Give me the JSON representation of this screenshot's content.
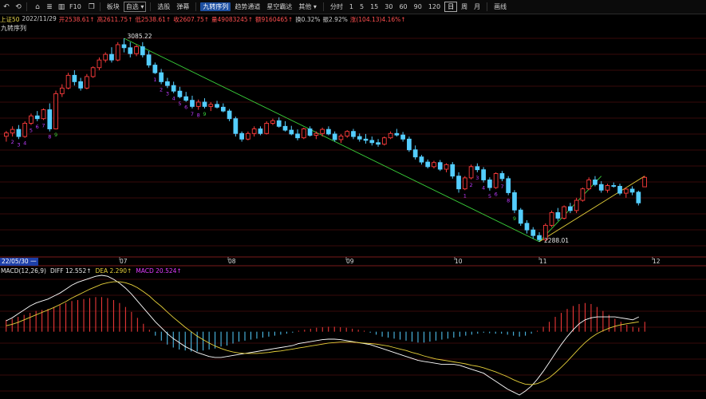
{
  "toolbar": {
    "icons": [
      "back-arrow-icon",
      "refresh-icon",
      "home-icon",
      "list-icon",
      "chart-icon",
      "f10-icon",
      "window-icon"
    ],
    "labels": {
      "f10": "F10",
      "blocks": "板块",
      "self": "自选",
      "select": "选股",
      "barrage": "弹幕",
      "jiuzhuan": "九转序列",
      "trend": "趋势通道",
      "dragon": "星空霸达",
      "other": "其他"
    },
    "periods": [
      "分时",
      "1",
      "5",
      "15",
      "30",
      "60",
      "90",
      "120",
      "日",
      "周",
      "月"
    ],
    "active_period": "日",
    "draw": "画线"
  },
  "info": {
    "name": "上证50",
    "date": "2022/11/29",
    "open": "开2538.61↑",
    "high": "高2611.75↑",
    "low": "低2538.61↑",
    "close": "收2607.75↑",
    "volume": "量49083245↑",
    "amount": "额9160465↑",
    "turnover": "换0.32%",
    "amplitude": "振2.92%",
    "change": "涨(104.13)4.16%↑"
  },
  "seq_label": "九转序列",
  "macd_legend": {
    "title": "MACD(12,26,9)",
    "diff": "DIFF 12.552↑",
    "dea": "DEA 2.290↑",
    "macd": "MACD 20.524↑"
  },
  "colors": {
    "up": "#ff3c3c",
    "down": "#54ceff",
    "diff": "#ffffff",
    "dea": "#e6d13a",
    "seq": "#c03cff",
    "seq9": "#3ad13a",
    "trend": "#3ad13a"
  },
  "chart_data": {
    "type": "candlestick",
    "title": "上证50",
    "annotations": {
      "high": "3085.22",
      "low": "2288.01"
    },
    "xlabels": [
      "22/05/30 一",
      "07",
      "08",
      "09",
      "10",
      "11",
      "12"
    ],
    "ylim": [
      2250,
      3110
    ],
    "candles": [
      [
        2701,
        2722,
        2680,
        2714
      ],
      [
        2714,
        2740,
        2700,
        2728
      ],
      [
        2728,
        2745,
        2690,
        2700
      ],
      [
        2700,
        2760,
        2695,
        2752
      ],
      [
        2752,
        2790,
        2745,
        2781
      ],
      [
        2781,
        2800,
        2760,
        2770
      ],
      [
        2770,
        2810,
        2765,
        2805
      ],
      [
        2805,
        2830,
        2720,
        2730
      ],
      [
        2730,
        2880,
        2728,
        2868
      ],
      [
        2868,
        2905,
        2855,
        2890
      ],
      [
        2890,
        2950,
        2885,
        2940
      ],
      [
        2940,
        2960,
        2900,
        2915
      ],
      [
        2915,
        2930,
        2880,
        2890
      ],
      [
        2890,
        2945,
        2885,
        2935
      ],
      [
        2935,
        2975,
        2930,
        2970
      ],
      [
        2970,
        3010,
        2960,
        3000
      ],
      [
        3000,
        3030,
        2990,
        3022
      ],
      [
        3022,
        3050,
        2990,
        3000
      ],
      [
        3000,
        3070,
        2995,
        3060
      ],
      [
        3060,
        3085,
        3030,
        3048
      ],
      [
        3048,
        3070,
        3010,
        3025
      ],
      [
        3025,
        3060,
        3015,
        3052
      ],
      [
        3052,
        3070,
        3010,
        3020
      ],
      [
        3020,
        3035,
        2970,
        2980
      ],
      [
        2980,
        2990,
        2945,
        2950
      ],
      [
        2950,
        2965,
        2905,
        2915
      ],
      [
        2915,
        2930,
        2890,
        2900
      ],
      [
        2900,
        2915,
        2870,
        2878
      ],
      [
        2878,
        2895,
        2850,
        2856
      ],
      [
        2856,
        2875,
        2836,
        2842
      ],
      [
        2842,
        2860,
        2810,
        2818
      ],
      [
        2818,
        2845,
        2805,
        2835
      ],
      [
        2835,
        2850,
        2810,
        2818
      ],
      [
        2818,
        2835,
        2800,
        2826
      ],
      [
        2826,
        2840,
        2810,
        2815
      ],
      [
        2815,
        2830,
        2795,
        2800
      ],
      [
        2800,
        2808,
        2760,
        2770
      ],
      [
        2770,
        2778,
        2700,
        2712
      ],
      [
        2712,
        2720,
        2680,
        2690
      ],
      [
        2690,
        2720,
        2685,
        2712
      ],
      [
        2712,
        2740,
        2700,
        2730
      ],
      [
        2730,
        2740,
        2705,
        2712
      ],
      [
        2712,
        2760,
        2708,
        2752
      ],
      [
        2752,
        2770,
        2745,
        2762
      ],
      [
        2762,
        2775,
        2735,
        2740
      ],
      [
        2740,
        2760,
        2720,
        2725
      ],
      [
        2725,
        2742,
        2705,
        2710
      ],
      [
        2710,
        2728,
        2685,
        2695
      ],
      [
        2695,
        2735,
        2690,
        2730
      ],
      [
        2730,
        2740,
        2700,
        2705
      ],
      [
        2705,
        2720,
        2690,
        2712
      ],
      [
        2712,
        2735,
        2700,
        2728
      ],
      [
        2728,
        2740,
        2705,
        2710
      ],
      [
        2710,
        2720,
        2680,
        2688
      ],
      [
        2688,
        2710,
        2675,
        2702
      ],
      [
        2702,
        2725,
        2695,
        2720
      ],
      [
        2720,
        2730,
        2690,
        2700
      ],
      [
        2700,
        2712,
        2680,
        2690
      ],
      [
        2690,
        2710,
        2672,
        2685
      ],
      [
        2685,
        2700,
        2665,
        2676
      ],
      [
        2676,
        2690,
        2660,
        2670
      ],
      [
        2670,
        2700,
        2665,
        2695
      ],
      [
        2695,
        2720,
        2690,
        2712
      ],
      [
        2712,
        2730,
        2700,
        2706
      ],
      [
        2706,
        2718,
        2680,
        2690
      ],
      [
        2690,
        2700,
        2640,
        2648
      ],
      [
        2648,
        2665,
        2610,
        2620
      ],
      [
        2620,
        2628,
        2590,
        2600
      ],
      [
        2600,
        2610,
        2575,
        2582
      ],
      [
        2582,
        2605,
        2575,
        2598
      ],
      [
        2598,
        2608,
        2565,
        2572
      ],
      [
        2572,
        2595,
        2560,
        2590
      ],
      [
        2590,
        2600,
        2535,
        2545
      ],
      [
        2545,
        2560,
        2480,
        2495
      ],
      [
        2495,
        2545,
        2490,
        2538
      ],
      [
        2538,
        2590,
        2532,
        2582
      ],
      [
        2582,
        2595,
        2560,
        2570
      ],
      [
        2570,
        2580,
        2520,
        2530
      ],
      [
        2530,
        2540,
        2488,
        2500
      ],
      [
        2500,
        2560,
        2495,
        2555
      ],
      [
        2555,
        2565,
        2525,
        2535
      ],
      [
        2535,
        2545,
        2470,
        2480
      ],
      [
        2480,
        2490,
        2400,
        2412
      ],
      [
        2412,
        2420,
        2350,
        2360
      ],
      [
        2360,
        2372,
        2320,
        2334
      ],
      [
        2334,
        2345,
        2300,
        2312
      ],
      [
        2312,
        2325,
        2288,
        2296
      ],
      [
        2296,
        2360,
        2290,
        2352
      ],
      [
        2352,
        2410,
        2345,
        2402
      ],
      [
        2402,
        2420,
        2370,
        2380
      ],
      [
        2380,
        2430,
        2375,
        2425
      ],
      [
        2425,
        2440,
        2400,
        2410
      ],
      [
        2410,
        2460,
        2400,
        2450
      ],
      [
        2450,
        2500,
        2445,
        2495
      ],
      [
        2495,
        2540,
        2490,
        2530
      ],
      [
        2530,
        2545,
        2505,
        2512
      ],
      [
        2512,
        2525,
        2480,
        2490
      ],
      [
        2490,
        2515,
        2480,
        2508
      ],
      [
        2508,
        2520,
        2500,
        2505
      ],
      [
        2505,
        2515,
        2470,
        2478
      ],
      [
        2478,
        2500,
        2460,
        2494
      ],
      [
        2494,
        2505,
        2470,
        2482
      ],
      [
        2482,
        2488,
        2430,
        2440
      ],
      [
        2503,
        2545,
        2503,
        2540
      ]
    ],
    "macd": {
      "hist": [
        24,
        26,
        30,
        34,
        38,
        42,
        44,
        46,
        50,
        54,
        58,
        62,
        64,
        66,
        68,
        70,
        70,
        68,
        64,
        58,
        50,
        40,
        28,
        16,
        4,
        -8,
        -18,
        -26,
        -32,
        -36,
        -38,
        -40,
        -40,
        -38,
        -36,
        -34,
        -30,
        -28,
        -24,
        -20,
        -18,
        -16,
        -14,
        -12,
        -10,
        -8,
        -6,
        -4,
        -2,
        2,
        4,
        6,
        8,
        9,
        10,
        10,
        9,
        8,
        6,
        4,
        2,
        -2,
        -6,
        -10,
        -12,
        -14,
        -16,
        -18,
        -20,
        -22,
        -22,
        -20,
        -18,
        -16,
        -14,
        -12,
        -10,
        -8,
        -6,
        -4,
        -2,
        -3,
        -4,
        -4,
        -6,
        -8,
        -10,
        -8,
        -4,
        2,
        10,
        20,
        30,
        38,
        46,
        52,
        56,
        58,
        56,
        50,
        42,
        34,
        26,
        20,
        14,
        10,
        8,
        20
      ],
      "diff": [
        22,
        28,
        36,
        44,
        52,
        58,
        62,
        66,
        72,
        78,
        86,
        94,
        100,
        104,
        108,
        112,
        114,
        112,
        106,
        98,
        88,
        76,
        62,
        48,
        34,
        20,
        8,
        -4,
        -14,
        -22,
        -30,
        -36,
        -42,
        -46,
        -50,
        -52,
        -52,
        -50,
        -48,
        -46,
        -44,
        -42,
        -40,
        -38,
        -36,
        -34,
        -32,
        -30,
        -28,
        -24,
        -22,
        -20,
        -18,
        -16,
        -15,
        -15,
        -16,
        -18,
        -20,
        -22,
        -24,
        -26,
        -30,
        -34,
        -38,
        -42,
        -46,
        -50,
        -54,
        -58,
        -60,
        -62,
        -64,
        -66,
        -66,
        -66,
        -68,
        -72,
        -76,
        -80,
        -84,
        -92,
        -100,
        -108,
        -116,
        -122,
        -128,
        -120,
        -110,
        -96,
        -80,
        -62,
        -44,
        -26,
        -10,
        4,
        16,
        24,
        28,
        30,
        30,
        30,
        30,
        28,
        26,
        24,
        30
      ],
      "dea": [
        12,
        15,
        19,
        24,
        29,
        34,
        39,
        44,
        49,
        55,
        61,
        68,
        74,
        80,
        86,
        91,
        96,
        99,
        101,
        101,
        99,
        95,
        89,
        81,
        72,
        61,
        51,
        40,
        29,
        19,
        9,
        0,
        -9,
        -16,
        -23,
        -29,
        -34,
        -38,
        -41,
        -43,
        -44,
        -44,
        -44,
        -43,
        -42,
        -40,
        -39,
        -37,
        -35,
        -33,
        -31,
        -29,
        -27,
        -25,
        -23,
        -22,
        -21,
        -21,
        -21,
        -22,
        -23,
        -24,
        -25,
        -27,
        -29,
        -32,
        -35,
        -38,
        -42,
        -45,
        -49,
        -52,
        -55,
        -57,
        -59,
        -61,
        -63,
        -65,
        -68,
        -70,
        -73,
        -77,
        -81,
        -86,
        -91,
        -97,
        -102,
        -106,
        -107,
        -105,
        -100,
        -93,
        -83,
        -72,
        -60,
        -47,
        -34,
        -22,
        -12,
        -4,
        2,
        7,
        11,
        14,
        16,
        18,
        20
      ]
    },
    "seq_marks": [
      {
        "i": 1,
        "t": "2"
      },
      {
        "i": 2,
        "t": "3"
      },
      {
        "i": 3,
        "t": "4"
      },
      {
        "i": 4,
        "t": "5"
      },
      {
        "i": 5,
        "t": "6"
      },
      {
        "i": 6,
        "t": "7"
      },
      {
        "i": 7,
        "t": "8"
      },
      {
        "i": 8,
        "t": "9"
      },
      {
        "i": 24,
        "t": "1"
      },
      {
        "i": 25,
        "t": "2"
      },
      {
        "i": 26,
        "t": "3"
      },
      {
        "i": 27,
        "t": "4"
      },
      {
        "i": 28,
        "t": "5"
      },
      {
        "i": 29,
        "t": "6"
      },
      {
        "i": 30,
        "t": "7"
      },
      {
        "i": 31,
        "t": "8"
      },
      {
        "i": 32,
        "t": "9"
      },
      {
        "i": 74,
        "t": "1"
      },
      {
        "i": 75,
        "t": "2"
      },
      {
        "i": 76,
        "t": "3"
      },
      {
        "i": 77,
        "t": "4"
      },
      {
        "i": 78,
        "t": "5"
      },
      {
        "i": 79,
        "t": "6"
      },
      {
        "i": 80,
        "t": "7"
      },
      {
        "i": 81,
        "t": "8"
      },
      {
        "i": 82,
        "t": "9"
      }
    ]
  }
}
